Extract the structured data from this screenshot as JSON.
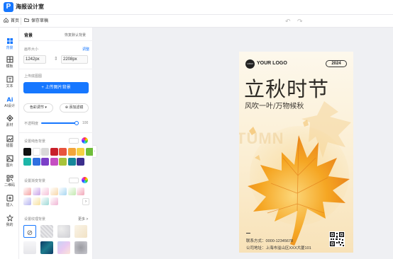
{
  "app": {
    "logo_letter": "P",
    "title": "海报设计室"
  },
  "toolbar": {
    "home_label": "首页",
    "save_label": "保存草稿"
  },
  "nav": [
    {
      "label": "背景",
      "icon": "background-icon",
      "active": true
    },
    {
      "label": "模板",
      "icon": "template-icon",
      "active": false
    },
    {
      "label": "文本",
      "icon": "text-icon",
      "active": false
    },
    {
      "label": "AI设计",
      "icon": "ai-icon",
      "active": false
    },
    {
      "label": "素材",
      "icon": "shapes-icon",
      "active": false
    },
    {
      "label": "插图",
      "icon": "illustration-icon",
      "active": false
    },
    {
      "label": "图片",
      "icon": "image-icon",
      "active": false
    },
    {
      "label": "二维码",
      "icon": "qrcode-icon",
      "active": false
    },
    {
      "label": "插入",
      "icon": "insert-icon",
      "active": false
    },
    {
      "label": "我的",
      "icon": "star-icon",
      "active": false
    }
  ],
  "panel": {
    "title": "背景",
    "restore_label": "恢复默认背景",
    "canvas_size_label": "画布大小",
    "adjust_link": "调整",
    "width_value": "1242px",
    "height_value": "2208px",
    "upload_section_label": "上传底图图",
    "upload_button": "+ 上传图片背景",
    "color_adjust_button": "色彩调节 ▾",
    "add_filter_button": "添加滤镜",
    "opacity_label": "不透明度",
    "opacity_value": "100",
    "solid_color_label": "设置纯色背景",
    "solid_colors": [
      "#111111",
      "#ffffff",
      "#d9d9d9",
      "#c8202b",
      "#e8533e",
      "#f3a53a",
      "#f6d144",
      "#6fbd3a",
      "#1db6a8",
      "#2f6fe0",
      "#7b3fc8",
      "#c54fc2",
      "#a7c33a",
      "#16879a",
      "#3b2f8c"
    ],
    "gradient_label": "设置渐变背景",
    "gradient_colors": [
      "#f5a3a3",
      "#c9a3e8",
      "#f6c2d9",
      "#f8d7a8",
      "#a9d7f2",
      "#c3e9b0",
      "#f2a7b8",
      "#b6b4f0",
      "#f7e1a0",
      "#9ed9d6",
      "#f0b6d4"
    ],
    "texture_label": "设置纹理背景",
    "more_link": "更多 >"
  },
  "poster": {
    "logo_dot_text": "LOGO",
    "logo_text": "YOUR LOGO",
    "year_badge": "2024",
    "headline": "立秋时节",
    "subheadline": "风吹一叶/万物候秋",
    "watermark": "TUMN",
    "phone_label": "联系方式：",
    "phone_value": "0000-12345678",
    "address_label": "公司地址：",
    "address_value": "上海市溢山区XXX大厦101"
  },
  "colors": {
    "accent": "#1677ff",
    "leaf": "#f0a020"
  }
}
